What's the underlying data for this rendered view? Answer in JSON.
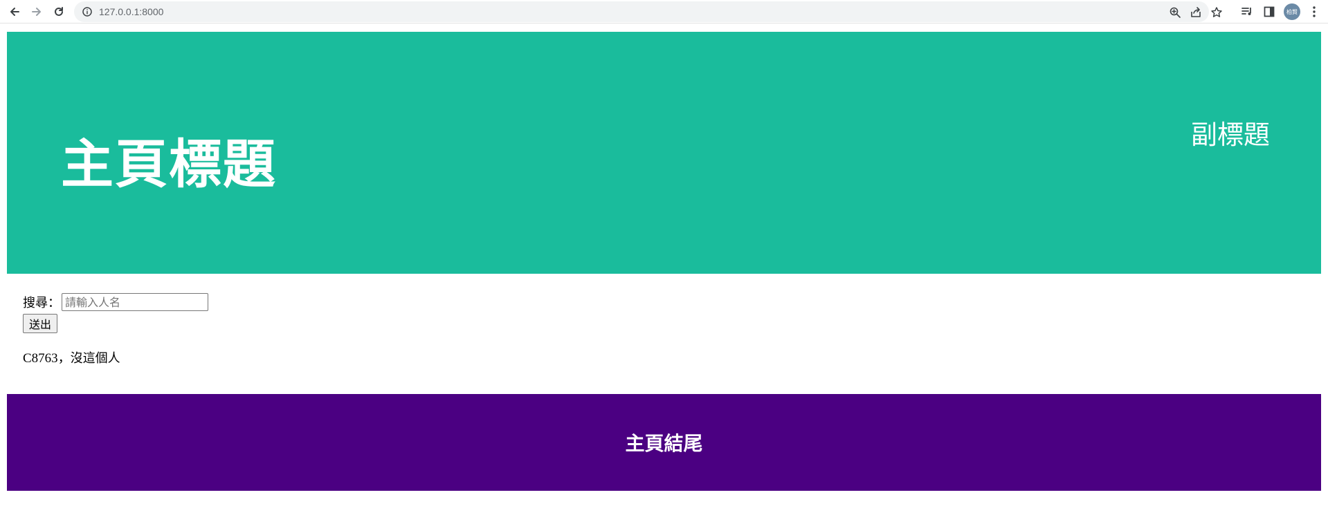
{
  "browser": {
    "url": "127.0.0.1:8000",
    "profile_initials": "柏賢",
    "icons": {
      "back": "arrow-left-icon",
      "forward": "arrow-right-icon",
      "reload": "reload-icon",
      "site_info": "info-icon",
      "zoom": "zoom-icon",
      "share": "share-icon",
      "bookmark": "star-icon",
      "reading_list": "reading-list-icon",
      "side_panel": "side-panel-icon",
      "menu": "kebab-menu-icon"
    }
  },
  "header": {
    "title": "主頁標題",
    "subtitle": "副標題",
    "background": "#1abc9c"
  },
  "search": {
    "label": "搜尋：",
    "placeholder": "請輸入人名",
    "value": "",
    "submit_label": "送出"
  },
  "result": {
    "code": "C8763",
    "message": "，沒這個人"
  },
  "footer": {
    "title": "主頁結尾",
    "background": "#4b0082"
  }
}
